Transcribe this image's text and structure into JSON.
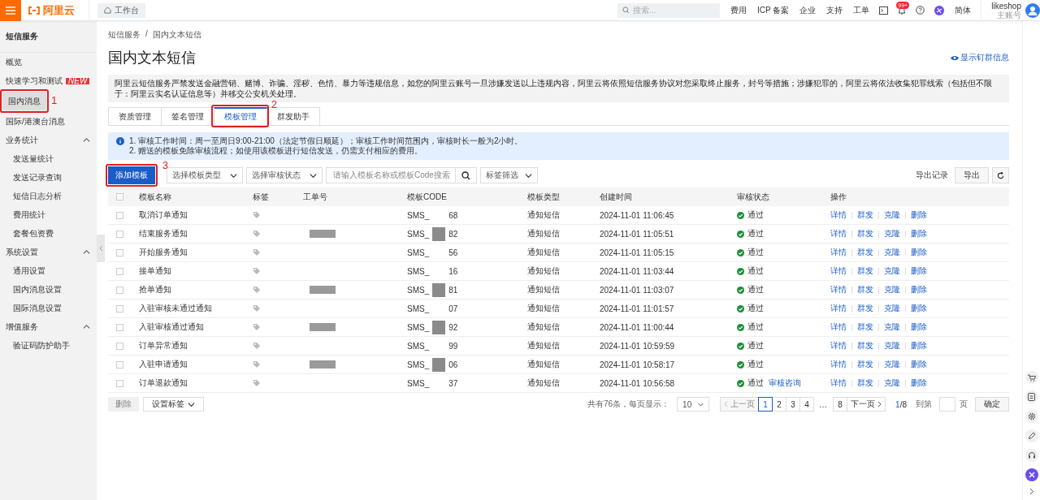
{
  "topbar": {
    "logo": "阿里云",
    "workbench": "工作台",
    "search": {
      "placeholder": "搜索..."
    },
    "links": [
      "费用",
      "ICP 备案",
      "企业",
      "支持",
      "工单"
    ],
    "badge": "99+",
    "language": "简体",
    "user": {
      "name": "likeshop",
      "role": "主账号"
    }
  },
  "sidebar": {
    "title": "短信服务",
    "items": [
      {
        "label": "概览",
        "kind": "item",
        "selected": false
      },
      {
        "label": "快速学习和测试",
        "kind": "item",
        "selected": false,
        "badge": "NEW"
      },
      {
        "label": "国内消息",
        "kind": "item",
        "selected": true,
        "annotation": "1"
      },
      {
        "label": "国际/港澳台消息",
        "kind": "item",
        "selected": false
      },
      {
        "label": "业务统计",
        "kind": "group",
        "expanded": true,
        "children": [
          {
            "label": "发送量统计",
            "selected": false
          },
          {
            "label": "发送记录查询",
            "selected": false
          },
          {
            "label": "短信日志分析",
            "selected": false
          },
          {
            "label": "费用统计",
            "selected": false
          },
          {
            "label": "套餐包资费",
            "selected": false
          }
        ]
      },
      {
        "label": "系统设置",
        "kind": "group",
        "expanded": true,
        "children": [
          {
            "label": "通用设置",
            "selected": false
          },
          {
            "label": "国内消息设置",
            "selected": false
          },
          {
            "label": "国际消息设置",
            "selected": false
          }
        ]
      },
      {
        "label": "增值服务",
        "kind": "group",
        "expanded": true,
        "children": [
          {
            "label": "验证码防护助手",
            "selected": false
          }
        ]
      }
    ]
  },
  "breadcrumb": [
    "短信服务",
    "国内文本短信"
  ],
  "breadcrumb_separator": "/",
  "title": "国内文本短信",
  "header_link": "显示钉群信息",
  "notice": "阿里云短信服务严禁发送金融营销、赌博、诈骗、淫秽、色情、暴力等违规信息，如您的阿里云账号一旦涉嫌发送以上违规内容，阿里云将依照短信服务协议对您采取终止服务，封号等措施；涉嫌犯罪的，阿里云将依法收集犯罪线索（包括但不限于：阿里云实名认证信息等）并移交公安机关处理。",
  "tabs": [
    {
      "label": "资质管理",
      "selected": false
    },
    {
      "label": "签名管理",
      "selected": false
    },
    {
      "label": "模板管理",
      "selected": true,
      "annotation": "2"
    },
    {
      "label": "群发助手",
      "selected": false
    }
  ],
  "info": [
    "1. 审核工作时间：周一至周日9:00-21:00（法定节假日顺延）；审核工作时间范围内，审核时长一般为2小时。",
    "2. 赠送的模板免除审核流程；如使用该模板进行短信发送，仍需支付相应的费用。"
  ],
  "toolbar": {
    "add_button": {
      "label": "添加模板",
      "annotation": "3"
    },
    "selects": [
      "选择模板类型",
      "选择审核状态"
    ],
    "search": {
      "placeholder": "请输入模板名称或模板Code搜索"
    },
    "tag_filter": "标签筛选",
    "export_log": "导出记录",
    "export": "导出"
  },
  "table": {
    "select_all_checked": false,
    "columns": [
      "模板名称",
      "标签",
      "工单号",
      "模板CODE",
      "模板类型",
      "创建时间",
      "审核状态",
      "操作"
    ],
    "rows": [
      {
        "checked": false,
        "name": "取消订单通知",
        "order_redacted": false,
        "code_prefix": "SMS_",
        "code_redacted": false,
        "code_suffix": "68",
        "type": "通知短信",
        "created": "2024-11-01 11:06:45",
        "status": "通过",
        "actions": [
          "详情",
          "群发",
          "克隆",
          "删除"
        ]
      },
      {
        "checked": false,
        "name": "结束服务通知",
        "order_redacted": true,
        "code_prefix": "SMS_",
        "code_redacted": true,
        "code_suffix": "82",
        "type": "通知短信",
        "created": "2024-11-01 11:05:51",
        "status": "通过",
        "actions": [
          "详情",
          "群发",
          "克隆",
          "删除"
        ]
      },
      {
        "checked": false,
        "name": "开始服务通知",
        "order_redacted": false,
        "code_prefix": "SMS_",
        "code_redacted": false,
        "code_suffix": "56",
        "type": "通知短信",
        "created": "2024-11-01 11:05:15",
        "status": "通过",
        "actions": [
          "详情",
          "群发",
          "克隆",
          "删除"
        ]
      },
      {
        "checked": false,
        "name": "接单通知",
        "order_redacted": false,
        "code_prefix": "SMS_",
        "code_redacted": false,
        "code_suffix": "16",
        "type": "通知短信",
        "created": "2024-11-01 11:03:44",
        "status": "通过",
        "actions": [
          "详情",
          "群发",
          "克隆",
          "删除"
        ]
      },
      {
        "checked": false,
        "name": "抢单通知",
        "order_redacted": true,
        "code_prefix": "SMS_",
        "code_redacted": true,
        "code_suffix": "81",
        "type": "通知短信",
        "created": "2024-11-01 11:03:07",
        "status": "通过",
        "actions": [
          "详情",
          "群发",
          "克隆",
          "删除"
        ]
      },
      {
        "checked": false,
        "name": "入驻审核未通过通知",
        "order_redacted": false,
        "code_prefix": "SMS_",
        "code_redacted": false,
        "code_suffix": "07",
        "type": "通知短信",
        "created": "2024-11-01 11:01:57",
        "status": "通过",
        "actions": [
          "详情",
          "群发",
          "克隆",
          "删除"
        ]
      },
      {
        "checked": false,
        "name": "入驻审核通过通知",
        "order_redacted": true,
        "code_prefix": "SMS_",
        "code_redacted": true,
        "code_suffix": "92",
        "type": "通知短信",
        "created": "2024-11-01 11:00:44",
        "status": "通过",
        "actions": [
          "详情",
          "群发",
          "克隆",
          "删除"
        ]
      },
      {
        "checked": false,
        "name": "订单异常通知",
        "order_redacted": false,
        "code_prefix": "SMS_",
        "code_redacted": false,
        "code_suffix": "99",
        "type": "通知短信",
        "created": "2024-11-01 10:59:59",
        "status": "通过",
        "actions": [
          "详情",
          "群发",
          "克隆",
          "删除"
        ]
      },
      {
        "checked": false,
        "name": "入驻申请通知",
        "order_redacted": true,
        "code_prefix": "SMS_",
        "code_redacted": true,
        "code_suffix": "06",
        "type": "通知短信",
        "created": "2024-11-01 10:58:17",
        "status": "通过",
        "actions": [
          "详情",
          "群发",
          "克隆",
          "删除"
        ]
      },
      {
        "checked": false,
        "name": "订单退款通知",
        "order_redacted": false,
        "code_prefix": "SMS_",
        "code_redacted": false,
        "code_suffix": "37",
        "type": "通知短信",
        "created": "2024-11-01 10:56:58",
        "status": "通过",
        "status_link": "审核咨询",
        "actions": [
          "详情",
          "群发",
          "克隆",
          "删除"
        ]
      }
    ]
  },
  "footer": {
    "delete": {
      "label": "删除",
      "disabled": true
    },
    "set_tag": "设置标签",
    "total": "共有76条，每页显示：",
    "page_size": "10",
    "prev": {
      "label": "上一页",
      "disabled": true
    },
    "pages": [
      {
        "label": "1",
        "selected": true
      },
      {
        "label": "2",
        "selected": false
      },
      {
        "label": "3",
        "selected": false
      },
      {
        "label": "4",
        "selected": false
      },
      {
        "label": "…",
        "kind": "ellipsis"
      },
      {
        "label": "8",
        "selected": false
      }
    ],
    "next": "下一页",
    "current": "1",
    "total_pages": "/8",
    "goto": "到第",
    "page_unit": "页",
    "confirm": "确定"
  }
}
